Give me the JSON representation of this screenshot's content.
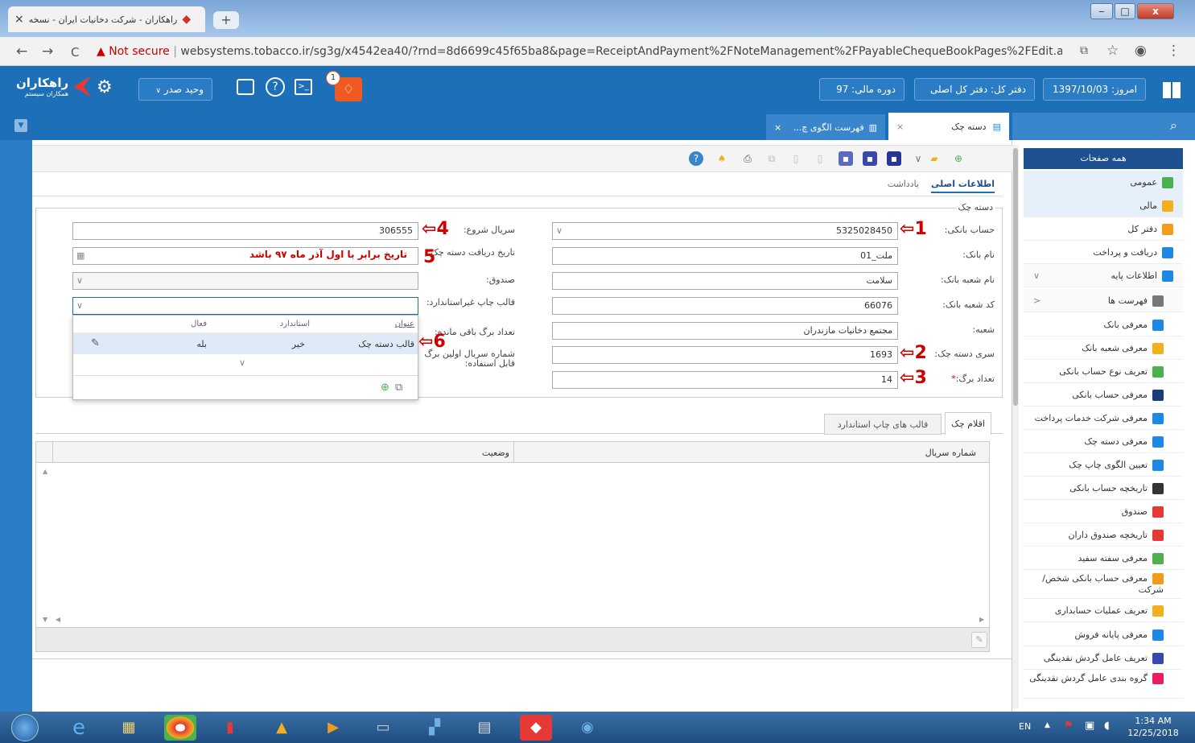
{
  "browser": {
    "tab_title": "راهکاران - شرکت دخانیات ایران - نسخه",
    "tab_close": "×",
    "new_tab": "+",
    "win_minimize": "‒",
    "win_maximize": "□",
    "win_close": "x",
    "nav_back": "←",
    "nav_forward": "→",
    "nav_reload": "C",
    "security_label": "Not secure",
    "url": "websystems.tobacco.ir/sg3g/x4542ea40/?rnd=8d6699c45f65ba8&page=ReceiptAndPayment%2FNoteManagement%2FPayableChequeBookPages%2FEdit.aspx"
  },
  "header": {
    "logo_text": "راهکاران",
    "logo_sub": "همکاران سیستم",
    "user_button": "وحید صدر",
    "notification_count": "1",
    "date": "امروز: 1397/10/03",
    "ledger": "دفتر کل: دفتر کل اصلی",
    "fiscal_year": "دوره مالی: 97"
  },
  "tabs": [
    {
      "label": "دسته چک",
      "close": "×"
    },
    {
      "label": "فهرست الگوی چ...",
      "close": "×"
    }
  ],
  "subtabs": {
    "main_info": "اطلاعات اصلی",
    "note": "یادداشت"
  },
  "form": {
    "group_title": "دسته چک",
    "bank_account": {
      "label": "حساب بانکی:",
      "value": "5325028450"
    },
    "bank_name": {
      "label": "نام بانک:",
      "value": "ملت_01"
    },
    "branch_name": {
      "label": "نام شعبه بانک:",
      "value": "سلامت"
    },
    "branch_code": {
      "label": "کد شعبه بانک:",
      "value": "66076"
    },
    "branch": {
      "label": "شعبه:",
      "value": "مجتمع دخانیات مازندران"
    },
    "series": {
      "label": "سری دسته چک:",
      "value": "1693"
    },
    "sheet_count": {
      "label": "تعداد برگ:",
      "value": "14",
      "required": "*"
    },
    "start_serial": {
      "label": "سریال شروع:",
      "value": "306555"
    },
    "receive_date": {
      "label": "تاریخ دریافت دسته چک:",
      "value": ""
    },
    "cashbox": {
      "label": "صندوق:",
      "value": ""
    },
    "print_template": {
      "label": "قالب چاپ غیراستاندارد:",
      "value": ""
    },
    "remaining": {
      "label": "تعداد برگ باقی مانده:"
    },
    "first_serial": {
      "label": "شماره سریال اولین برگ قابل استفاده:"
    }
  },
  "dropdown": {
    "headers": {
      "title": "عنوان",
      "standard": "استاندارد",
      "active": "فعال"
    },
    "rows": [
      {
        "title": "قالب دسته چک",
        "standard": "خیر",
        "active": "بله"
      }
    ]
  },
  "annotations": {
    "n1": "1",
    "n2": "2",
    "n3": "3",
    "n4": "4",
    "n5": "5",
    "n6": "6",
    "note5": "تاریخ برابر با اول آذر ماه ۹۷ باشد"
  },
  "lower_tabs": {
    "items": "اقلام چک",
    "templates": "قالب های چاپ استاندارد"
  },
  "grid": {
    "col_serial": "شماره سریال",
    "col_status": "وضعیت"
  },
  "sidebar": {
    "all_pages": "همه صفحات",
    "items": [
      {
        "label": "عمومی",
        "color": "#4caf50"
      },
      {
        "label": "مالی",
        "color": "#f2b01e"
      },
      {
        "label": "دفتر کل",
        "color": "#f29c1e"
      },
      {
        "label": "دریافت و پرداخت",
        "color": "#1e88e5"
      },
      {
        "label": "اطلاعات پایه",
        "color": "#1e88e5"
      },
      {
        "label": "فهرست ها",
        "color": "#777777"
      },
      {
        "label": "معرفی بانک",
        "color": "#1e88e5"
      },
      {
        "label": "معرفی شعبه بانک",
        "color": "#f2b01e"
      },
      {
        "label": "تعریف نوع حساب بانکی",
        "color": "#4caf50"
      },
      {
        "label": "معرفی حساب بانکی",
        "color": "#1a3c7a"
      },
      {
        "label": "معرفی شرکت خدمات پرداخت",
        "color": "#1e88e5"
      },
      {
        "label": "معرفی دسته چک",
        "color": "#1e88e5"
      },
      {
        "label": "تعیین الگوی چاپ چک",
        "color": "#1e88e5"
      },
      {
        "label": "تاریخچه حساب بانکی",
        "color": "#333333"
      },
      {
        "label": "صندوق",
        "color": "#e53935"
      },
      {
        "label": "تاریخچه صندوق داران",
        "color": "#e53935"
      },
      {
        "label": "معرفی سفته سفید",
        "color": "#4caf50"
      },
      {
        "label": "معرفی حساب بانکی شخص/شرکت",
        "color": "#f29c1e"
      },
      {
        "label": "تعریف عملیات حسابداری",
        "color": "#f2b01e"
      },
      {
        "label": "معرفی پایانه فروش",
        "color": "#1e88e5"
      },
      {
        "label": "تعریف عامل گردش نقدینگی",
        "color": "#3949ab"
      },
      {
        "label": "گروه بندی عامل گردش نقدینگی",
        "color": "#e91e63"
      }
    ]
  },
  "taskbar": {
    "lang": "EN",
    "time": "1:34 AM",
    "date": "12/25/2018"
  }
}
